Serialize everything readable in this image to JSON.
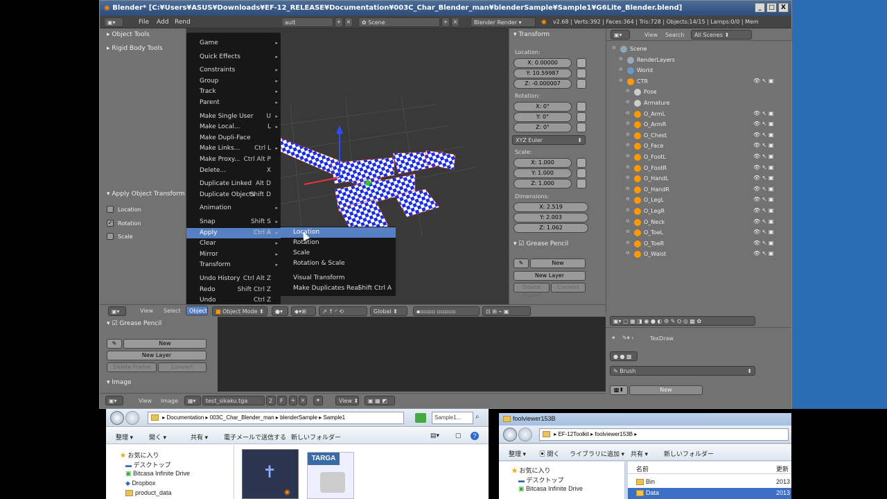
{
  "window": {
    "title": "Blender* [C:¥Users¥ASUS¥Downloads¥EF-12_RELEASE¥Documentation¥003C_Char_Blender_man¥blenderSample¥Sample1¥G6Lite_Blender.blend]",
    "min": "_",
    "max": "□",
    "close": "X"
  },
  "infobar": {
    "file": "File",
    "add": "Add",
    "render": "Rend",
    "layout": "ault",
    "scene": "Scene",
    "engine": "Blender Render",
    "stats": "v2.68 | Verts:392 | Faces:364 | Tris:728 | Objects:14/15 | Lamps:0/0 | Mem"
  },
  "toolshelf": {
    "object_tools": "Object Tools",
    "rigid_body": "Rigid Body Tools",
    "apply_transform": "Apply Object Transform",
    "location": "Location",
    "rotation": "Rotation",
    "scale": "Scale"
  },
  "object_menu": {
    "title": "Object Menu",
    "items": [
      {
        "label": "Game",
        "shortcut": "",
        "sub": true
      },
      {
        "label": "Quick Effects",
        "shortcut": "",
        "sub": true
      },
      {
        "label": "Constraints",
        "shortcut": "",
        "sub": true
      },
      {
        "label": "Group",
        "shortcut": "",
        "sub": true
      },
      {
        "label": "Track",
        "shortcut": "",
        "sub": true
      },
      {
        "label": "Parent",
        "shortcut": "",
        "sub": true
      },
      {
        "label": "Make Single User",
        "shortcut": "U",
        "sub": true
      },
      {
        "label": "Make Local...",
        "shortcut": "L",
        "sub": true
      },
      {
        "label": "Make Dupli-Face",
        "shortcut": "",
        "sub": false
      },
      {
        "label": "Make Links...",
        "shortcut": "Ctrl L",
        "sub": true
      },
      {
        "label": "Make Proxy...",
        "shortcut": "Ctrl Alt P",
        "sub": false
      },
      {
        "label": "Delete...",
        "shortcut": "X",
        "sub": false
      },
      {
        "label": "Duplicate Linked",
        "shortcut": "Alt D",
        "sub": false
      },
      {
        "label": "Duplicate Objects",
        "shortcut": "Shift D",
        "sub": false
      },
      {
        "label": "Animation",
        "shortcut": "",
        "sub": true
      },
      {
        "label": "Snap",
        "shortcut": "Shift S",
        "sub": true
      },
      {
        "label": "Apply",
        "shortcut": "Ctrl A",
        "sub": true
      },
      {
        "label": "Clear",
        "shortcut": "",
        "sub": true
      },
      {
        "label": "Mirror",
        "shortcut": "",
        "sub": true
      },
      {
        "label": "Transform",
        "shortcut": "",
        "sub": true
      },
      {
        "label": "Undo History",
        "shortcut": "Ctrl Alt Z",
        "sub": false
      },
      {
        "label": "Redo",
        "shortcut": "Shift Ctrl Z",
        "sub": false
      },
      {
        "label": "Undo",
        "shortcut": "Ctrl Z",
        "sub": false
      }
    ]
  },
  "apply_menu": {
    "items": [
      {
        "label": "Location",
        "shortcut": ""
      },
      {
        "label": "Rotation",
        "shortcut": ""
      },
      {
        "label": "Scale",
        "shortcut": ""
      },
      {
        "label": "Rotation & Scale",
        "shortcut": ""
      },
      {
        "label": "Visual Transform",
        "shortcut": ""
      },
      {
        "label": "Make Duplicates Real",
        "shortcut": "Shift Ctrl A"
      }
    ]
  },
  "viewport_header": {
    "view": "View",
    "select": "Select",
    "object": "Object",
    "mode": "Object Mode",
    "orientation": "Global"
  },
  "transform": {
    "title": "Transform",
    "location_label": "Location:",
    "loc": [
      "X: 0.00000",
      "Y: 10.59987",
      "Z: -0.000007"
    ],
    "rotation_label": "Rotation:",
    "rot": [
      "X: 0°",
      "Y: 0°",
      "Z: 0°"
    ],
    "rot_mode": "XYZ Euler",
    "scale_label": "Scale:",
    "scale": [
      "X: 1.000",
      "Y: 1.000",
      "Z: 1.000"
    ],
    "dimensions_label": "Dimensions:",
    "dim": [
      "X: 2.519",
      "Y: 2.003",
      "Z: 1.062"
    ],
    "grease_pencil": "Grease Pencil",
    "new": "New",
    "new_layer": "New Layer",
    "delete_frame": "Delete Frame",
    "convert": "Convert"
  },
  "outliner": {
    "view": "View",
    "search": "Search",
    "filter": "All Scenes",
    "rows": [
      {
        "label": "Scene",
        "depth": 0
      },
      {
        "label": "RenderLayers",
        "depth": 1
      },
      {
        "label": "World",
        "depth": 1
      },
      {
        "label": "CTR",
        "depth": 1
      },
      {
        "label": "Pose",
        "depth": 2
      },
      {
        "label": "Armature",
        "depth": 2
      },
      {
        "label": "O_ArmL",
        "depth": 2
      },
      {
        "label": "O_ArmR",
        "depth": 2
      },
      {
        "label": "O_Chest",
        "depth": 2
      },
      {
        "label": "O_Face",
        "depth": 2
      },
      {
        "label": "O_FootL",
        "depth": 2
      },
      {
        "label": "O_FootR",
        "depth": 2
      },
      {
        "label": "O_HandL",
        "depth": 2
      },
      {
        "label": "O_HandR",
        "depth": 2
      },
      {
        "label": "O_LegL",
        "depth": 2
      },
      {
        "label": "O_LegR",
        "depth": 2
      },
      {
        "label": "O_Neck",
        "depth": 2
      },
      {
        "label": "O_ToeL",
        "depth": 2
      },
      {
        "label": "O_ToeR",
        "depth": 2
      },
      {
        "label": "O_Waist",
        "depth": 2
      }
    ]
  },
  "grease_bottom": {
    "title": "Grease Pencil",
    "new": "New",
    "new_layer": "New Layer",
    "delete_frame": "Delete Frame",
    "convert": "Convert",
    "image": "Image"
  },
  "image_header": {
    "view": "View",
    "image": "Image",
    "image_name": "test_sikaku.tga",
    "users": "2",
    "fake": "F",
    "view2": "View"
  },
  "brush_panel": {
    "texdraw": "TexDraw",
    "brush": "Brush",
    "new": "New"
  },
  "explorer1": {
    "path": [
      "Documentation",
      "003C_Char_Blender_man",
      "blenderSample",
      "Sample1"
    ],
    "search": "Sample1...",
    "organize": "整理 ▾",
    "open": "開く ▾",
    "share": "共有 ▾",
    "email": "電子メールで送信する",
    "new_folder": "新しいフォルダー",
    "favorites": "お気に入り",
    "side": [
      "デスクトップ",
      "Bitcasa Infinite Drive",
      "Dropbox",
      "product_data"
    ],
    "file_label": "TARGA"
  },
  "explorer2": {
    "title": "foolviewer153B",
    "path": [
      "EF-12Toolkit",
      "foolviewer153B"
    ],
    "organize": "整理 ▾",
    "open": "開く",
    "library": "ライブラリに追加 ▾",
    "share": "共有 ▾",
    "new_folder": "新しいフォルダー",
    "favorites": "お気に入り",
    "side": [
      "デスクトップ",
      "Bitcasa Infinite Drive"
    ],
    "col_name": "名前",
    "col_date": "更新",
    "rows": [
      {
        "name": "Bin",
        "date": "2013"
      },
      {
        "name": "Data",
        "date": "2013"
      }
    ]
  }
}
